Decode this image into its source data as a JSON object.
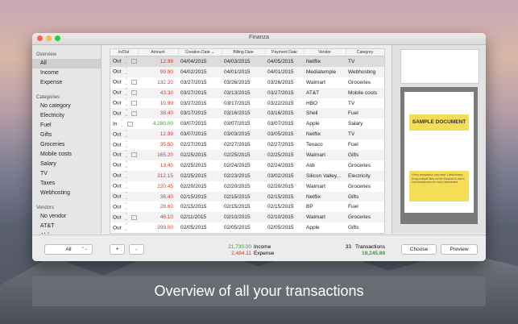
{
  "window": {
    "title": "Finanza"
  },
  "sidebar": {
    "sections": [
      {
        "heading": "Overview",
        "items": [
          "All",
          "Income",
          "Expense"
        ]
      },
      {
        "heading": "Categories",
        "items": [
          "No category",
          "Electricity",
          "Fuel",
          "Gifts",
          "Groceries",
          "Mobile costs",
          "Salary",
          "TV",
          "Taxes",
          "Webhosting"
        ]
      },
      {
        "heading": "Vendors",
        "items": [
          "No vendor",
          "AT&T",
          "Aldi"
        ]
      }
    ],
    "selected": "All",
    "filter_select": "All"
  },
  "table": {
    "columns": [
      "In/Out",
      "Amount",
      "Creation Date",
      "Billing Date",
      "Payment Date",
      "Vendor",
      "Category"
    ],
    "sorted_column": "Creation Date",
    "rows": [
      {
        "dir": "Out",
        "amount": "12.99",
        "created": "04/04/2015",
        "billing": "04/03/2015",
        "payment": "04/05/2015",
        "vendor": "Netflix",
        "category": "TV",
        "att": true,
        "sel": true
      },
      {
        "dir": "Out",
        "amount": "99.90",
        "created": "04/02/2015",
        "billing": "04/01/2015",
        "payment": "04/01/2015",
        "vendor": "Mediatemple",
        "category": "Webhosting",
        "att": false
      },
      {
        "dir": "Out",
        "amount": "132.20",
        "created": "03/27/2015",
        "billing": "03/26/2015",
        "payment": "03/26/2015",
        "vendor": "Walmart",
        "category": "Groceries",
        "att": true
      },
      {
        "dir": "Out",
        "amount": "43.30",
        "created": "03/27/2015",
        "billing": "03/13/2015",
        "payment": "03/27/2015",
        "vendor": "AT&T",
        "category": "Mobile costs",
        "att": true
      },
      {
        "dir": "Out",
        "amount": "10.99",
        "created": "03/27/2015",
        "billing": "03/17/2015",
        "payment": "03/22/2015",
        "vendor": "HBO",
        "category": "TV",
        "att": true
      },
      {
        "dir": "Out",
        "amount": "38.40",
        "created": "03/17/2015",
        "billing": "03/16/2015",
        "payment": "03/16/2015",
        "vendor": "Shell",
        "category": "Fuel",
        "att": true
      },
      {
        "dir": "In",
        "amount": "4,280.00",
        "created": "03/07/2015",
        "billing": "03/07/2015",
        "payment": "03/07/2015",
        "vendor": "Apple",
        "category": "Salary",
        "att": true
      },
      {
        "dir": "Out",
        "amount": "12.99",
        "created": "03/07/2015",
        "billing": "03/03/2015",
        "payment": "03/05/2015",
        "vendor": "Netflix",
        "category": "TV",
        "att": false
      },
      {
        "dir": "Out",
        "amount": "35.50",
        "created": "02/27/2015",
        "billing": "02/27/2015",
        "payment": "02/27/2015",
        "vendor": "Texaco",
        "category": "Fuel",
        "att": false
      },
      {
        "dir": "Out",
        "amount": "165.20",
        "created": "02/25/2015",
        "billing": "02/25/2015",
        "payment": "02/25/2015",
        "vendor": "Walmart",
        "category": "Gifts",
        "att": true
      },
      {
        "dir": "Out",
        "amount": "13.40",
        "created": "02/25/2015",
        "billing": "02/24/2015",
        "payment": "02/24/2015",
        "vendor": "Aldi",
        "category": "Groceries",
        "att": false
      },
      {
        "dir": "Out",
        "amount": "312.15",
        "created": "02/25/2015",
        "billing": "02/23/2015",
        "payment": "03/02/2015",
        "vendor": "Silicon Valley...",
        "category": "Electricity",
        "att": false
      },
      {
        "dir": "Out",
        "amount": "220.45",
        "created": "02/20/2015",
        "billing": "02/20/2015",
        "payment": "02/20/2015",
        "vendor": "Walmart",
        "category": "Groceries",
        "att": false
      },
      {
        "dir": "Out",
        "amount": "36.40",
        "created": "02/15/2015",
        "billing": "02/15/2015",
        "payment": "02/15/2015",
        "vendor": "Netflix",
        "category": "Gifts",
        "att": false
      },
      {
        "dir": "Out",
        "amount": "28.60",
        "created": "02/15/2015",
        "billing": "02/15/2015",
        "payment": "02/15/2015",
        "vendor": "BP",
        "category": "Fuel",
        "att": false
      },
      {
        "dir": "Out",
        "amount": "46.10",
        "created": "02/11/2015",
        "billing": "02/10/2015",
        "payment": "02/10/2015",
        "vendor": "Walmart",
        "category": "Groceries",
        "att": true
      },
      {
        "dir": "Out",
        "amount": "399.00",
        "created": "02/05/2015",
        "billing": "02/05/2015",
        "payment": "02/05/2015",
        "vendor": "Apple",
        "category": "Gifts",
        "att": false
      }
    ]
  },
  "footer": {
    "add_label": "+",
    "remove_label": "-",
    "income_value": "21,730.00",
    "income_label": "Income",
    "expense_value": "2,484.11",
    "expense_label": "Expense",
    "count_value": "33",
    "count_label": "Transactions",
    "balance_value": "19,245.89",
    "choose_label": "Choose",
    "preview_label": "Preview"
  },
  "preview": {
    "doc_title": "SAMPLE DOCUMENT",
    "note_lines": [
      "Every transaction can have 1 attachment",
      "Drag multiple files on the Window to add a new transaction for every attachment"
    ]
  },
  "banner": {
    "text": "Overview of all your transactions"
  },
  "colors": {
    "income": "#3a9b3a",
    "expense": "#d0382f",
    "highlight": "#f5dd56"
  }
}
